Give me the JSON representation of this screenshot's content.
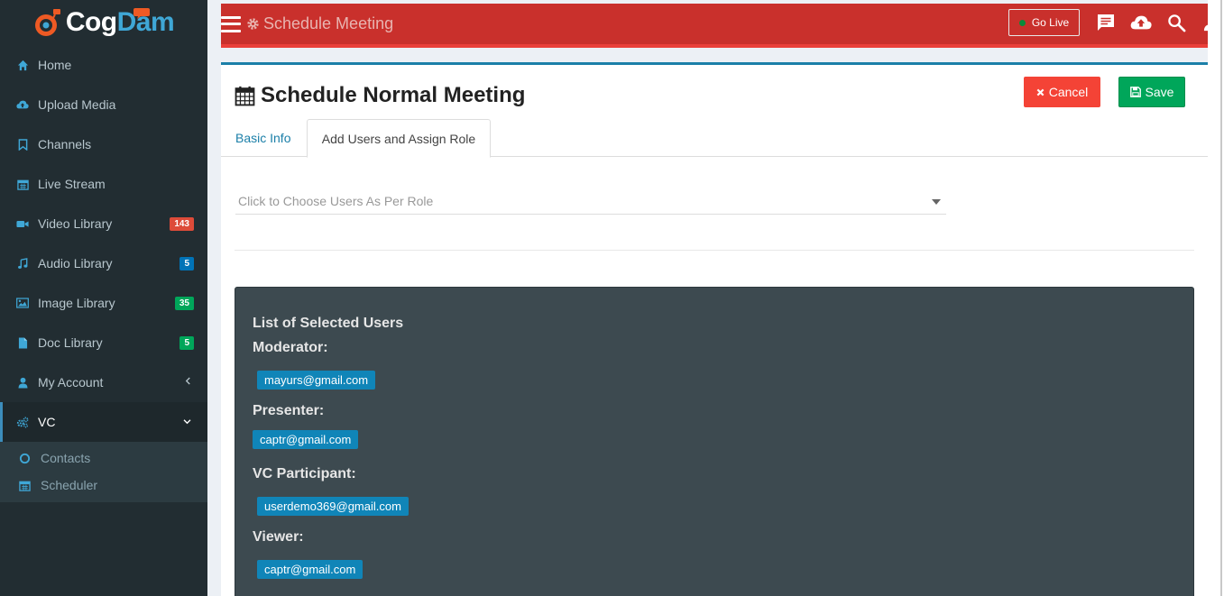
{
  "brand": {
    "part1": "Cog",
    "part2": "Dam",
    "colors": {
      "cog": "#ffffff",
      "dam": "#3fa7d6",
      "mark": "#ee5a24"
    }
  },
  "sidebar": {
    "items": [
      {
        "label": "Home",
        "icon": "home-icon"
      },
      {
        "label": "Upload Media",
        "icon": "cloud-upload-icon"
      },
      {
        "label": "Channels",
        "icon": "bookmark-icon"
      },
      {
        "label": "Live Stream",
        "icon": "calendar-icon"
      },
      {
        "label": "Video Library",
        "icon": "video-camera-icon",
        "badge": "143",
        "badge_color": "#dd4b39"
      },
      {
        "label": "Audio Library",
        "icon": "music-icon",
        "badge": "5",
        "badge_color": "#0073b7"
      },
      {
        "label": "Image Library",
        "icon": "image-icon",
        "badge": "35",
        "badge_color": "#00a65a"
      },
      {
        "label": "Doc Library",
        "icon": "document-icon",
        "badge": "5",
        "badge_color": "#00a65a"
      },
      {
        "label": "My Account",
        "icon": "user-icon"
      },
      {
        "label": "VC",
        "icon": "gears-icon"
      }
    ],
    "subitems": [
      {
        "label": "Contacts",
        "icon": "circle-icon"
      },
      {
        "label": "Scheduler",
        "icon": "calendar-icon"
      }
    ]
  },
  "header": {
    "title": "Schedule Meeting",
    "go_live": "Go Live",
    "color": "#c9302c"
  },
  "main": {
    "title": "Schedule Normal Meeting",
    "cancel_label": "Cancel",
    "save_label": "Save",
    "tabs": [
      {
        "label": "Basic Info"
      },
      {
        "label": "Add Users and Assign Role"
      }
    ],
    "select_placeholder": "Click to Choose Users As Per Role",
    "selected_users": {
      "heading": "List of Selected Users",
      "roles": [
        {
          "label": "Moderator:",
          "users": [
            "mayurs@gmail.com"
          ]
        },
        {
          "label": "Presenter:",
          "users": [
            "captr@gmail.com"
          ]
        },
        {
          "label": "VC Participant:",
          "users": [
            "userdemo369@gmail.com"
          ]
        },
        {
          "label": "Viewer:",
          "users": [
            "captr@gmail.com"
          ]
        }
      ]
    }
  }
}
